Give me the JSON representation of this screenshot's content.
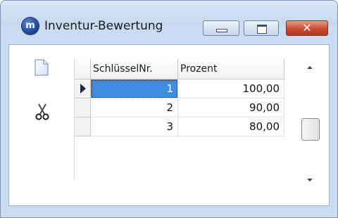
{
  "window": {
    "title": "Inventur-Bewertung",
    "icon_letter": "m",
    "controls": {
      "minimize": "minimize-icon",
      "maximize": "maximize-icon",
      "close_glyph": "✕"
    }
  },
  "toolbar": {
    "items": [
      {
        "name": "new-document-icon"
      },
      {
        "name": "scissors-icon"
      }
    ]
  },
  "grid": {
    "columns": [
      "SchlüsselNr.",
      "Prozent"
    ],
    "rows": [
      {
        "key": "1",
        "percent": "100,00",
        "current": true
      },
      {
        "key": "2",
        "percent": "90,00",
        "current": false
      },
      {
        "key": "3",
        "percent": "80,00",
        "current": false
      }
    ],
    "selected_row": 0
  },
  "colors": {
    "selection": "#3d8ee0",
    "titlebar": "#c9dcf1",
    "close_button": "#c84b32"
  }
}
